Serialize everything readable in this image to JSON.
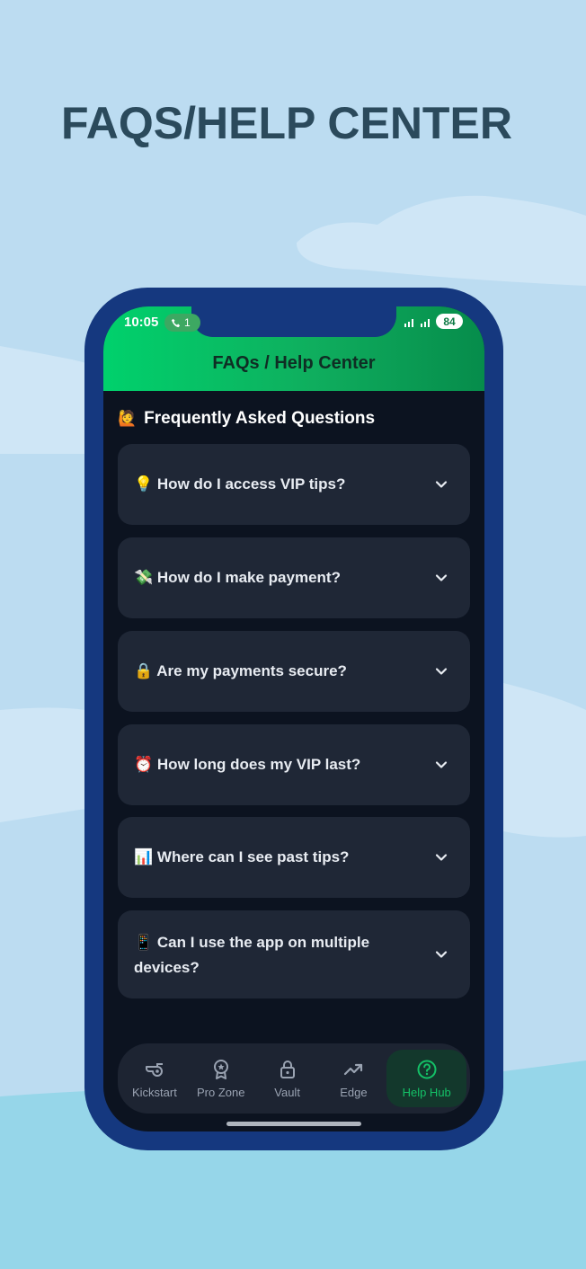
{
  "promo": {
    "title": "FAQS/HELP CENTER"
  },
  "status_bar": {
    "time": "10:05",
    "call_text": "1",
    "battery": "84"
  },
  "header": {
    "title": "FAQs / Help Center"
  },
  "section": {
    "emoji": "🙋",
    "title": "Frequently Asked Questions"
  },
  "faqs": [
    {
      "emoji": "💡",
      "question": "How do I access VIP tips?"
    },
    {
      "emoji": "💸",
      "question": "How do I make payment?"
    },
    {
      "emoji": "🔒",
      "question": "Are my payments secure?"
    },
    {
      "emoji": "⏰",
      "question": "How long does my VIP last?"
    },
    {
      "emoji": "📊",
      "question": "Where can I see past tips?"
    },
    {
      "emoji": "📱",
      "question": "Can I use the app on multiple devices?"
    }
  ],
  "nav": {
    "items": [
      {
        "label": "Kickstart",
        "icon": "whistle-icon"
      },
      {
        "label": "Pro Zone",
        "icon": "badge-star-icon"
      },
      {
        "label": "Vault",
        "icon": "lock-icon"
      },
      {
        "label": "Edge",
        "icon": "trending-up-icon"
      },
      {
        "label": "Help Hub",
        "icon": "help-circle-icon",
        "active": true
      }
    ]
  },
  "colors": {
    "accent": "#14c167",
    "header_gradient_start": "#00d16c",
    "phone_frame": "#15387f",
    "card": "#1f2736",
    "screen_bg": "#0c1320"
  }
}
